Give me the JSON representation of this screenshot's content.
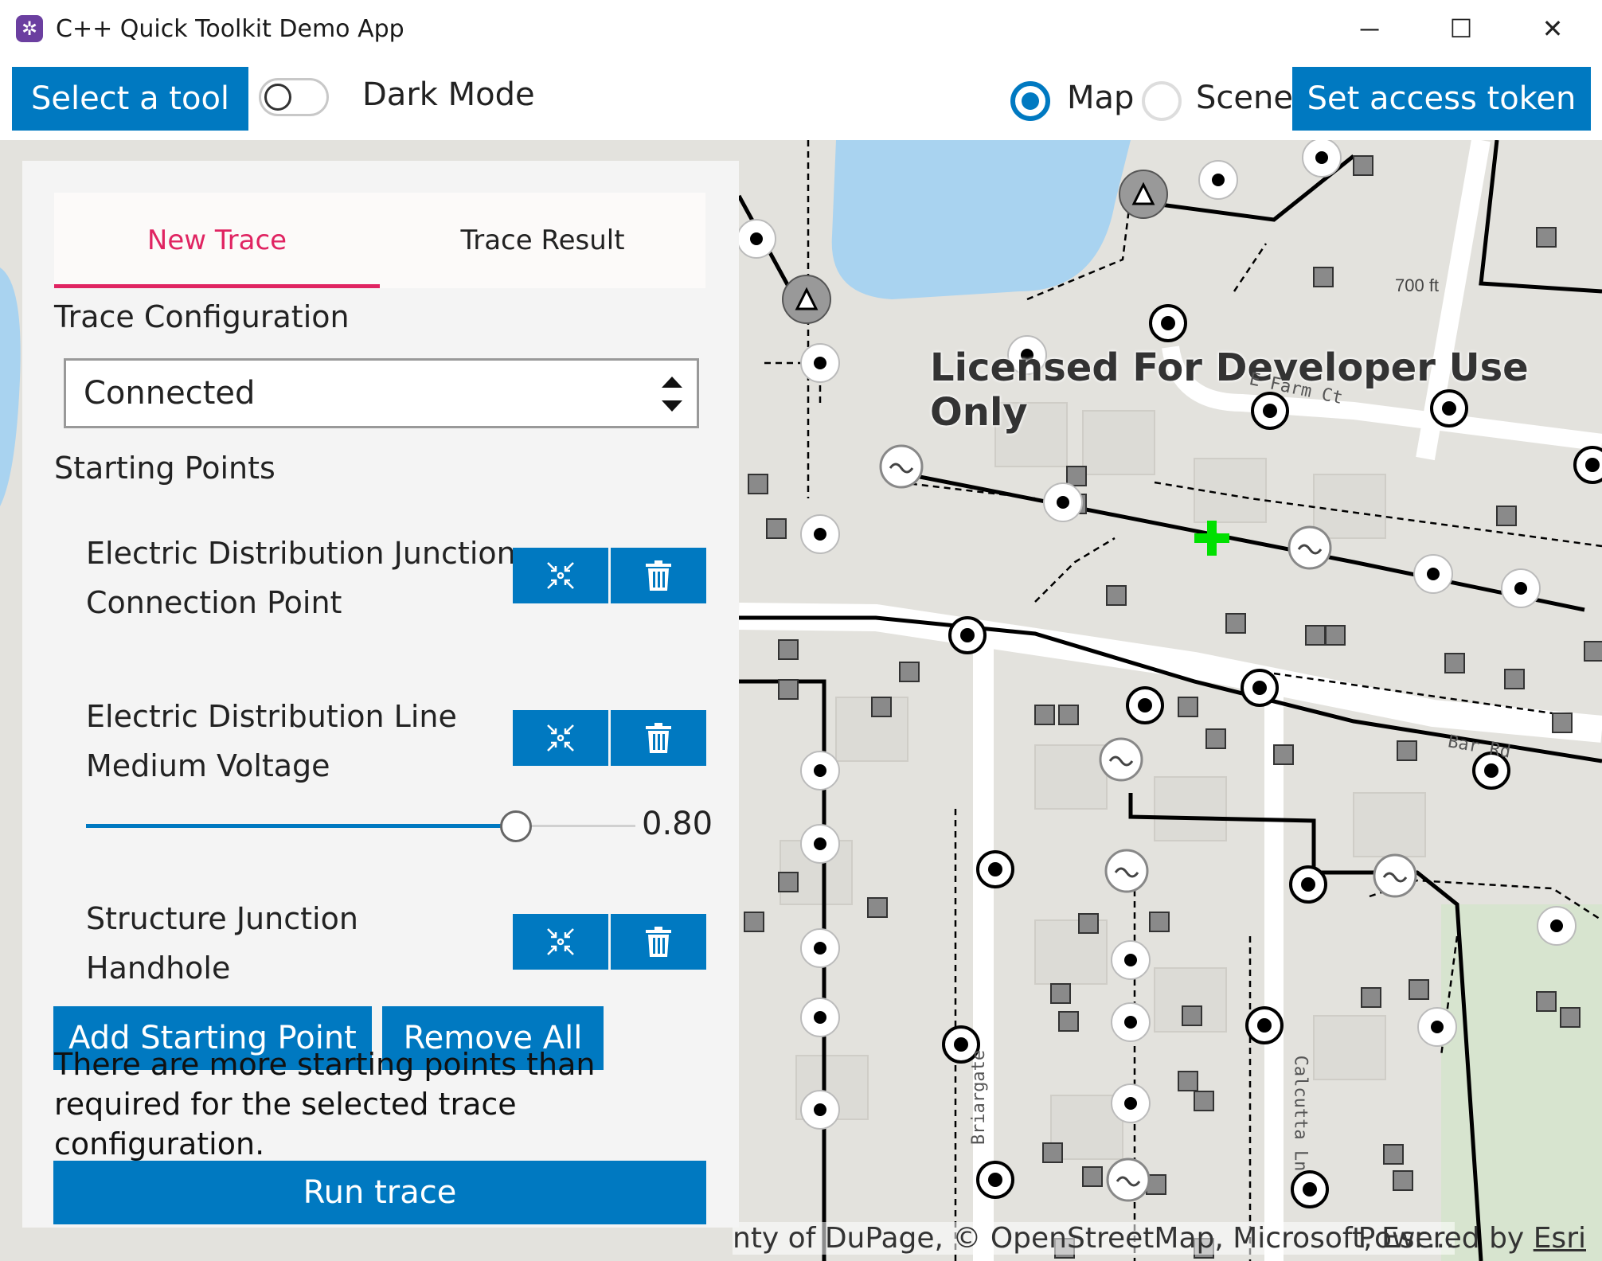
{
  "window": {
    "title": "C++ Quick Toolkit Demo App",
    "minimize": "─",
    "maximize": "☐",
    "close": "✕"
  },
  "toolbar": {
    "select_tool": "Select a tool",
    "dark_mode_label": "Dark Mode",
    "dark_mode_on": false,
    "view_options": [
      "Map",
      "Scene"
    ],
    "selected_view": "Map",
    "set_token": "Set access token"
  },
  "map": {
    "watermark": "Licensed For Developer Use Only",
    "attribution": "nty of DuPage, © OpenStreetMap, Microsoft, Esr…",
    "powered_by": "Powered by ",
    "powered_link": "Esri",
    "scale": "700 ft",
    "streets": [
      "E Farm Ct",
      "Bar Rd",
      "Briargate",
      "Calcutta Ln"
    ]
  },
  "panel": {
    "tabs": [
      "New Trace",
      "Trace Result"
    ],
    "active_tab": "New Trace",
    "trace_config_label": "Trace Configuration",
    "trace_config_value": "Connected",
    "starting_points_label": "Starting Points",
    "starting_points": [
      {
        "line1": "Electric Distribution Junction",
        "line2": "Connection Point"
      },
      {
        "line1": "Electric Distribution Line",
        "line2": "Medium Voltage",
        "fraction": 0.8,
        "fraction_label": "0.80"
      },
      {
        "line1": "Structure Junction",
        "line2": "Handhole"
      }
    ],
    "add_button": "Add Starting Point",
    "remove_all_button": "Remove All",
    "message": "There are more starting points than required for the selected trace configuration.",
    "run_button": "Run trace"
  },
  "colors": {
    "accent": "#0079c1",
    "tab_active": "#e02462",
    "panel_bg": "#f4f4f4",
    "map_bg": "#e3e2dd"
  }
}
